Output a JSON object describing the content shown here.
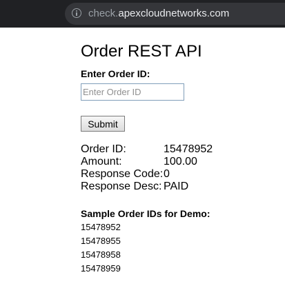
{
  "browser": {
    "url_subdomain": "check.",
    "url_domain": "apexcloudnetworks.com",
    "info_icon": "info-icon"
  },
  "page": {
    "title": "Order REST API",
    "input_label": "Enter Order ID:",
    "input_placeholder": "Enter Order ID",
    "input_value": "",
    "submit_label": "Submit"
  },
  "result": {
    "order_id_label": "Order ID:",
    "order_id_value": "15478952",
    "amount_label": "Amount:",
    "amount_value": "100.00",
    "response_code_label": "Response Code:",
    "response_code_value": "0",
    "response_desc_label": "Response Desc:",
    "response_desc_value": "PAID"
  },
  "samples": {
    "heading": "Sample Order IDs for Demo:",
    "ids": [
      "15478952",
      "15478955",
      "15478958",
      "15478959"
    ]
  }
}
